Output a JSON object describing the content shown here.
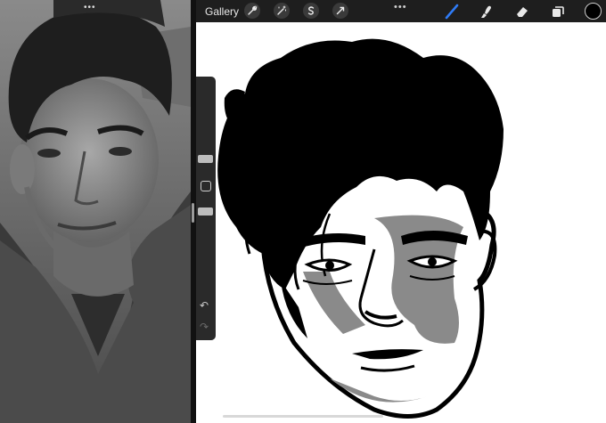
{
  "toolbar": {
    "gallery_label": "Gallery",
    "more_dots": "•••",
    "actions": [
      "wrench-icon",
      "magic-wand-icon",
      "selection-icon",
      "transform-arrow-icon"
    ],
    "tools": [
      "brush-icon",
      "smudge-icon",
      "eraser-icon",
      "layers-icon"
    ],
    "active_tool": "brush-icon",
    "current_color": "#000000",
    "accent_color": "#2f7bf6"
  },
  "reference_pane": {
    "multitask_dots": "•••"
  },
  "sidebar": {
    "brush_size_level": 0.42,
    "opacity_level": 0.73,
    "undo_symbol": "↶",
    "redo_symbol": "↷"
  }
}
